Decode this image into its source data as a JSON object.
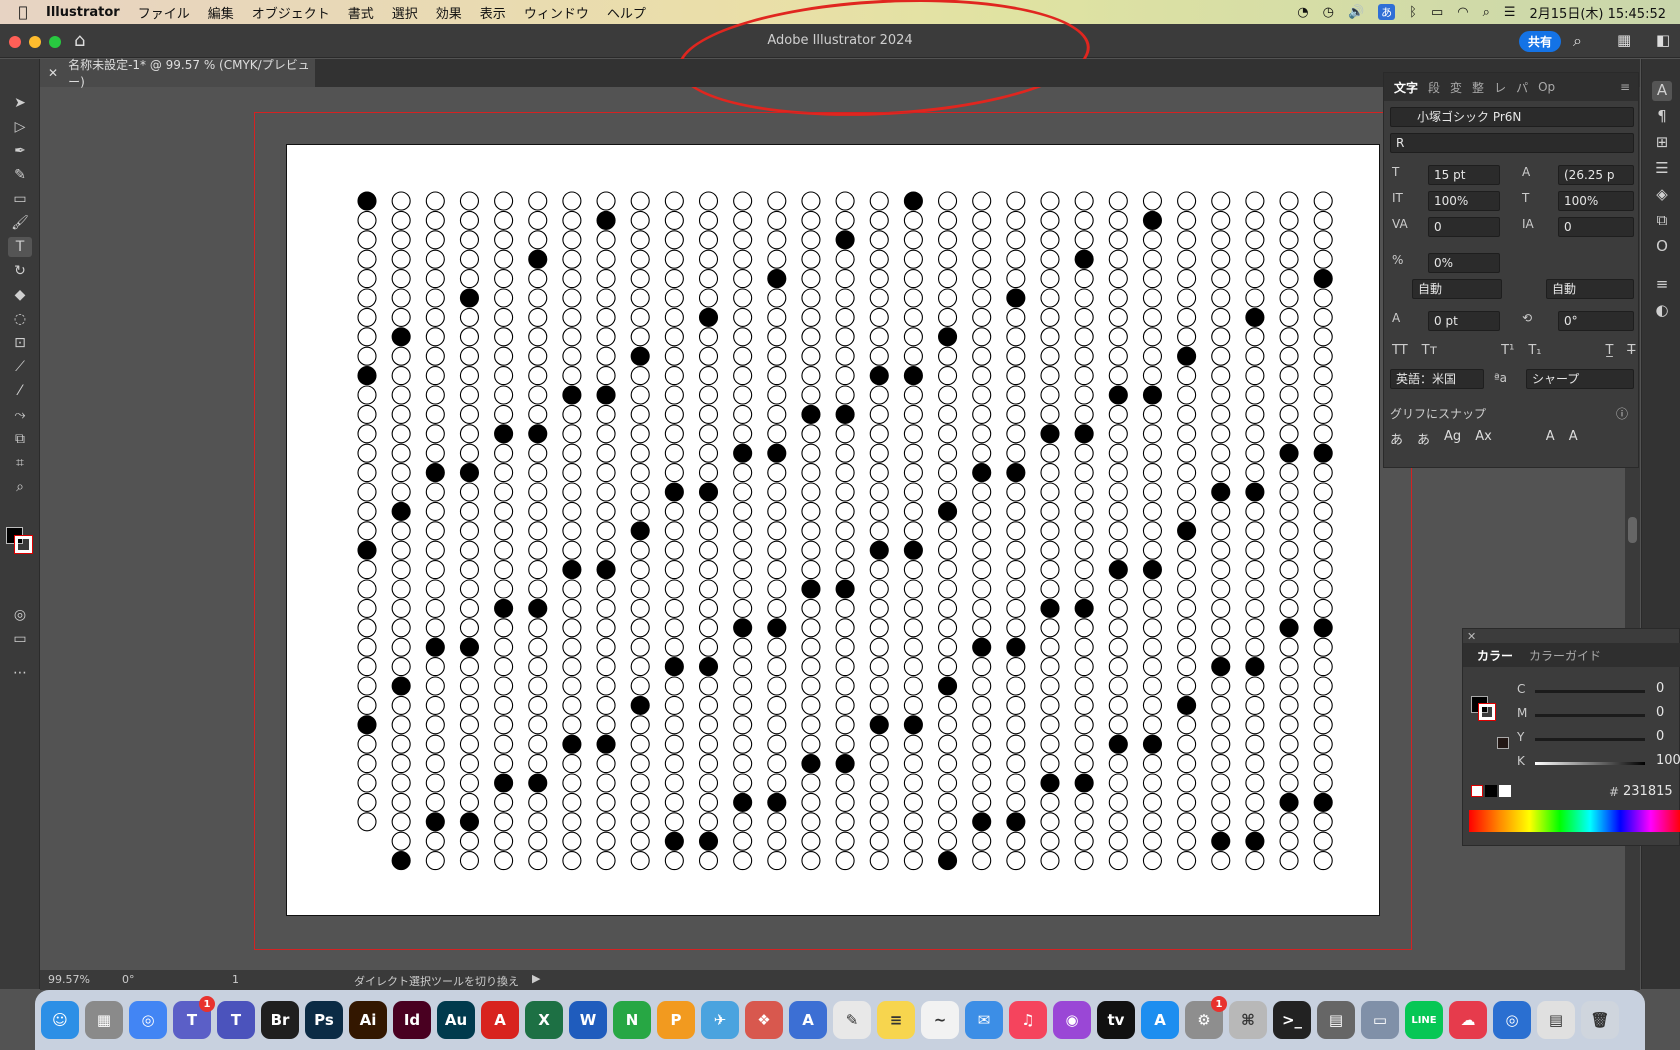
{
  "menubar": {
    "app_name": "Illustrator",
    "items": [
      "ファイル",
      "編集",
      "オブジェクト",
      "書式",
      "選択",
      "効果",
      "表示",
      "ウィンドウ",
      "ヘルプ"
    ],
    "ime": "あ",
    "clock": "2月15日(木) 15:45:52"
  },
  "titlebar": {
    "title": "Adobe Illustrator 2024",
    "share_label": "共有"
  },
  "document_tab": {
    "label": "名称未設定-1* @ 99.57 % (CMYK/プレビュー)"
  },
  "artwork": {
    "columns": 29,
    "rows": 35,
    "filled_color": "#000000",
    "stroke_color": "#000000"
  },
  "char_panel": {
    "tabs": [
      "文字",
      "段",
      "変",
      "整",
      "レ",
      "パ",
      "Op"
    ],
    "font_family": "小塚ゴシック Pr6N",
    "font_style": "R",
    "font_size": "15 pt",
    "leading": "(26.25 p",
    "vert_scale": "100%",
    "horiz_scale": "100%",
    "kerning": "0",
    "tracking": "0",
    "tsume": "0%",
    "aki_left": "自動",
    "aki_right": "自動",
    "baseline_shift": "0 pt",
    "rotation": "0°",
    "language": "英語：米国",
    "antialias": "シャープ",
    "snap_label": "グリフにスナップ"
  },
  "color_panel": {
    "tabs": [
      "カラー",
      "カラーガイド"
    ],
    "channels": [
      {
        "name": "C",
        "value": "0"
      },
      {
        "name": "M",
        "value": "0"
      },
      {
        "name": "Y",
        "value": "0"
      },
      {
        "name": "K",
        "value": "100"
      }
    ],
    "hex": "231815"
  },
  "statusbar": {
    "zoom": "99.57%",
    "angle": "0°",
    "artboard_num": "1",
    "tool_hint": "ダイレクト選択ツールを切り換え"
  },
  "dock": {
    "items": [
      {
        "name": "finder",
        "label": "☺",
        "color": "#2c8fe6"
      },
      {
        "name": "launchpad",
        "label": "▦",
        "color": "#8a8a8a"
      },
      {
        "name": "chrome",
        "label": "◎",
        "color": "#4285f4"
      },
      {
        "name": "teams-classic",
        "label": "T",
        "color": "#5b5fc7",
        "badge": "1"
      },
      {
        "name": "teams-new",
        "label": "T",
        "color": "#4b53bc"
      },
      {
        "name": "bridge",
        "label": "Br",
        "color": "#1f1f1f"
      },
      {
        "name": "photoshop",
        "label": "Ps",
        "color": "#0b2b45"
      },
      {
        "name": "illustrator",
        "label": "Ai",
        "color": "#331700"
      },
      {
        "name": "indesign",
        "label": "Id",
        "color": "#490021"
      },
      {
        "name": "audition",
        "label": "Au",
        "color": "#003a4d"
      },
      {
        "name": "acrobat",
        "label": "A",
        "color": "#d8231e"
      },
      {
        "name": "excel",
        "label": "X",
        "color": "#1d7044"
      },
      {
        "name": "word",
        "label": "W",
        "color": "#1f5cbd"
      },
      {
        "name": "numbers",
        "label": "N",
        "color": "#27a744"
      },
      {
        "name": "pages",
        "label": "P",
        "color": "#f29a1f"
      },
      {
        "name": "paper-plane",
        "label": "✈",
        "color": "#4aa3df"
      },
      {
        "name": "photo-app",
        "label": "❖",
        "color": "#d8584e"
      },
      {
        "name": "preview-like",
        "label": "A",
        "color": "#3c6fd4"
      },
      {
        "name": "textedit",
        "label": "✎",
        "color": "#e8e8e8"
      },
      {
        "name": "notes",
        "label": "≡",
        "color": "#f7d54e"
      },
      {
        "name": "freeform",
        "label": "~",
        "color": "#f2f2f2"
      },
      {
        "name": "mail",
        "label": "✉",
        "color": "#3c8ee6"
      },
      {
        "name": "music",
        "label": "♫",
        "color": "#f5445d"
      },
      {
        "name": "podcasts",
        "label": "◉",
        "color": "#9a47d6"
      },
      {
        "name": "appletv",
        "label": "tv",
        "color": "#111111"
      },
      {
        "name": "appstore",
        "label": "A",
        "color": "#1c8ef0"
      },
      {
        "name": "settings",
        "label": "⚙",
        "color": "#8e8e8e",
        "badge": "1"
      },
      {
        "name": "utility",
        "label": "⌘",
        "color": "#b8b8b8"
      },
      {
        "name": "terminal",
        "label": ">_",
        "color": "#222222"
      },
      {
        "name": "calculator",
        "label": "▤",
        "color": "#666666"
      },
      {
        "name": "scanner",
        "label": "▭",
        "color": "#8090a8"
      },
      {
        "name": "line",
        "label": "LINE",
        "color": "#06c755"
      },
      {
        "name": "creative-cloud",
        "label": "☁",
        "color": "#e63b4c"
      },
      {
        "name": "quicktime",
        "label": "◎",
        "color": "#2a6fd1"
      },
      {
        "name": "documents",
        "label": "▤",
        "color": "#e0e0e0"
      },
      {
        "name": "trash",
        "label": "🗑",
        "color": "#cfd5dd"
      }
    ]
  }
}
